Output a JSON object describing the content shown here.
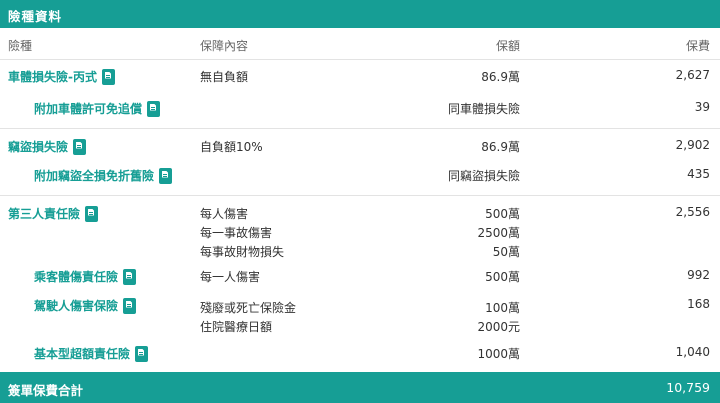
{
  "header": {
    "title": "險種資料"
  },
  "columns": {
    "type": "險種",
    "content": "保障內容",
    "amount": "保額",
    "premium": "保費"
  },
  "groups": [
    {
      "rows": [
        {
          "name": "車體損失險-丙式",
          "content": [
            "無自負額"
          ],
          "amount": [
            "86.9萬"
          ],
          "premium": "2,627"
        },
        {
          "name": "附加車體許可免追償",
          "content": [],
          "amount": [
            "同車體損失險"
          ],
          "premium": "39"
        }
      ]
    },
    {
      "rows": [
        {
          "name": "竊盜損失險",
          "content": [
            "自負額10%"
          ],
          "amount": [
            "86.9萬"
          ],
          "premium": "2,902"
        },
        {
          "name": "附加竊盜全損免折舊險",
          "content": [],
          "amount": [
            "同竊盜損失險"
          ],
          "premium": "435"
        }
      ]
    },
    {
      "rows": [
        {
          "name": "第三人責任險",
          "content": [
            "每人傷害",
            "每一事故傷害",
            "每事故財物損失"
          ],
          "amount": [
            "500萬",
            "2500萬",
            "50萬"
          ],
          "premium": "2,556"
        },
        {
          "name": "乘客體傷責任險",
          "content": [
            "每一人傷害"
          ],
          "amount": [
            "500萬"
          ],
          "premium": "992"
        },
        {
          "name": "駕駛人傷害保險",
          "content": [
            "殘廢或死亡保險金",
            "住院醫療日額"
          ],
          "amount": [
            "100萬",
            "2000元"
          ],
          "premium": "168"
        },
        {
          "name": "基本型超額責任險",
          "content": [],
          "amount": [
            "1000萬"
          ],
          "premium": "1,040"
        }
      ]
    }
  ],
  "footer": {
    "label": "簽單保費合計",
    "total": "10,759"
  },
  "colors": {
    "accent": "#169e95"
  }
}
